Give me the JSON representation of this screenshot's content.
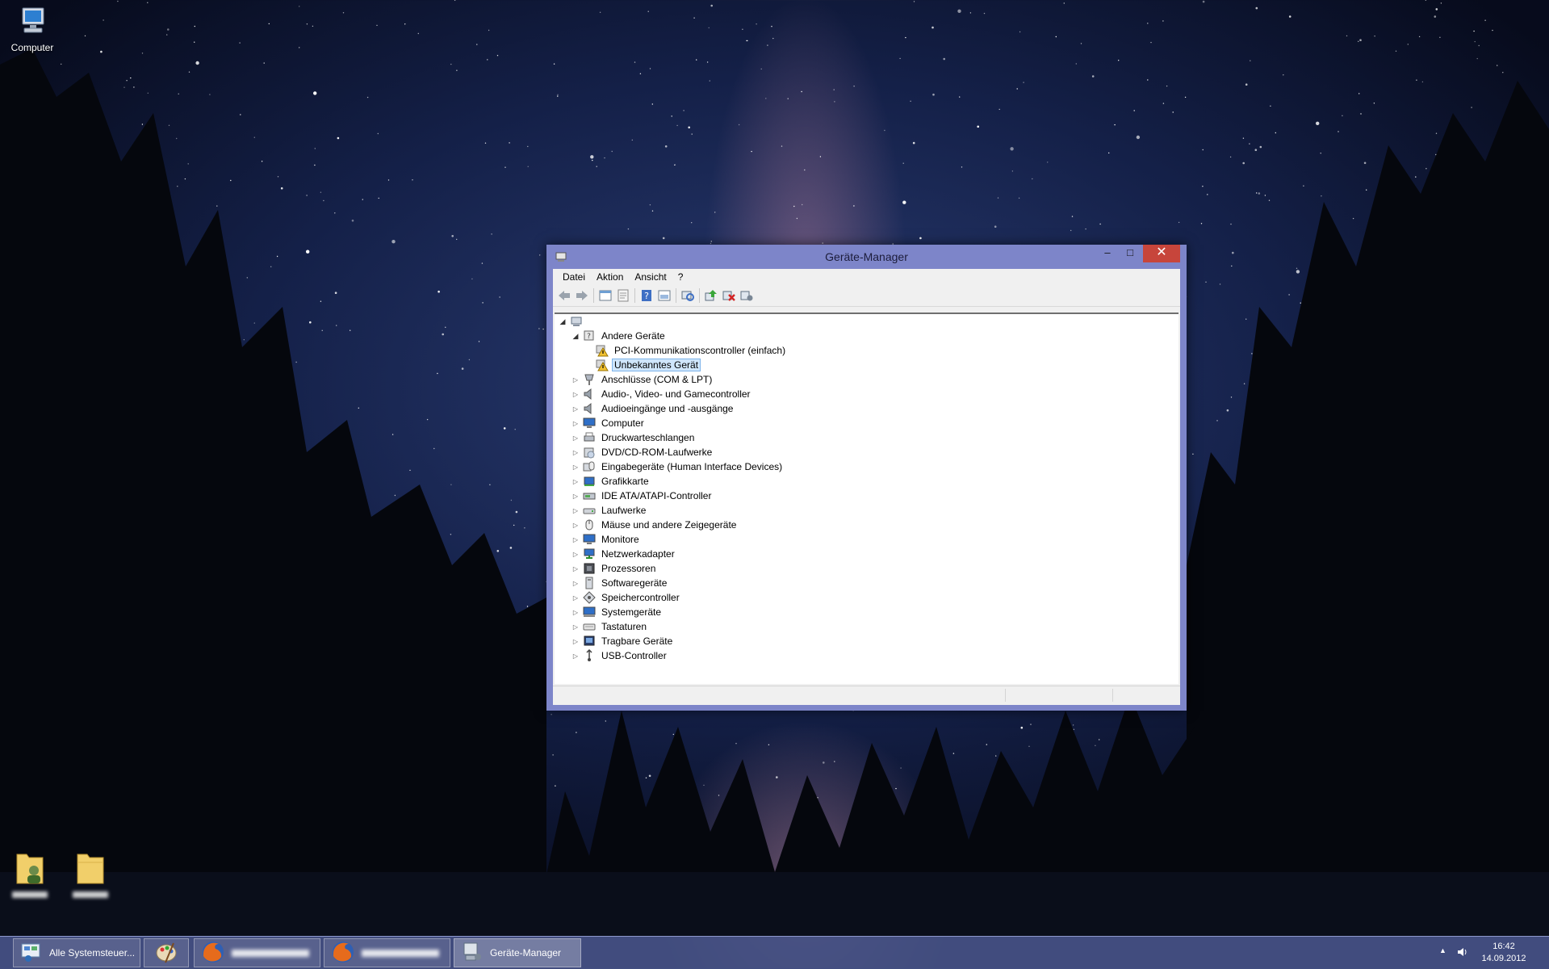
{
  "desktop": {
    "icons": [
      {
        "label": "Computer",
        "icon": "computer-icon"
      },
      {
        "label": "",
        "icon": "user-folder-icon"
      },
      {
        "label": "",
        "icon": "folder-icon"
      }
    ]
  },
  "window": {
    "title": "Geräte-Manager",
    "controls": {
      "minimize": "–",
      "maximize": "□",
      "close": "✕"
    },
    "menu": [
      "Datei",
      "Aktion",
      "Ansicht",
      "?"
    ],
    "toolbar": [
      "back-icon",
      "forward-icon",
      "properties-view-icon",
      "properties-icon",
      "help-icon",
      "show-hidden-icon",
      "scan-hardware-icon",
      "update-driver-icon",
      "uninstall-icon",
      "enable-device-icon"
    ],
    "tree": {
      "root": {
        "label": "",
        "icon": "computer-icon",
        "expanded": true
      },
      "items": [
        {
          "label": "Andere Geräte",
          "icon": "unknown-device-icon",
          "expanded": true,
          "level": 1
        },
        {
          "label": "PCI-Kommunikationscontroller (einfach)",
          "icon": "warning-device-icon",
          "level": 2
        },
        {
          "label": "Unbekanntes Gerät",
          "icon": "warning-device-icon",
          "level": 2,
          "selected": true
        },
        {
          "label": "Anschlüsse (COM & LPT)",
          "icon": "port-icon",
          "level": 1
        },
        {
          "label": "Audio-, Video- und Gamecontroller",
          "icon": "speaker-icon",
          "level": 1
        },
        {
          "label": "Audioeingänge und -ausgänge",
          "icon": "speaker-icon",
          "level": 1
        },
        {
          "label": "Computer",
          "icon": "monitor-icon",
          "level": 1
        },
        {
          "label": "Druckwarteschlangen",
          "icon": "printer-icon",
          "level": 1
        },
        {
          "label": "DVD/CD-ROM-Laufwerke",
          "icon": "dvd-icon",
          "level": 1
        },
        {
          "label": "Eingabegeräte (Human Interface Devices)",
          "icon": "hid-icon",
          "level": 1
        },
        {
          "label": "Grafikkarte",
          "icon": "display-adapter-icon",
          "level": 1
        },
        {
          "label": "IDE ATA/ATAPI-Controller",
          "icon": "ide-icon",
          "level": 1
        },
        {
          "label": "Laufwerke",
          "icon": "drive-icon",
          "level": 1
        },
        {
          "label": "Mäuse und andere Zeigegeräte",
          "icon": "mouse-icon",
          "level": 1
        },
        {
          "label": "Monitore",
          "icon": "monitor-icon",
          "level": 1
        },
        {
          "label": "Netzwerkadapter",
          "icon": "network-icon",
          "level": 1
        },
        {
          "label": "Prozessoren",
          "icon": "cpu-icon",
          "level": 1
        },
        {
          "label": "Softwaregeräte",
          "icon": "software-device-icon",
          "level": 1
        },
        {
          "label": "Speichercontroller",
          "icon": "storage-controller-icon",
          "level": 1
        },
        {
          "label": "Systemgeräte",
          "icon": "system-device-icon",
          "level": 1
        },
        {
          "label": "Tastaturen",
          "icon": "keyboard-icon",
          "level": 1
        },
        {
          "label": "Tragbare Geräte",
          "icon": "portable-device-icon",
          "level": 1
        },
        {
          "label": "USB-Controller",
          "icon": "usb-icon",
          "level": 1
        }
      ]
    }
  },
  "taskbar": {
    "items": [
      {
        "label": "Alle Systemsteuer...",
        "icon": "control-panel-icon"
      },
      {
        "label": "",
        "icon": "paint-icon"
      },
      {
        "label": "",
        "icon": "firefox-icon"
      },
      {
        "label": "",
        "icon": "firefox-icon"
      },
      {
        "label": "Geräte-Manager",
        "icon": "device-manager-icon",
        "active": true
      }
    ],
    "tray": {
      "time": "16:42",
      "date": "14.09.2012"
    }
  },
  "colors": {
    "window_frame": "#7d85c9",
    "close_button": "#c7453b",
    "selection": "#cfe6fb",
    "taskbar": "#465287"
  }
}
